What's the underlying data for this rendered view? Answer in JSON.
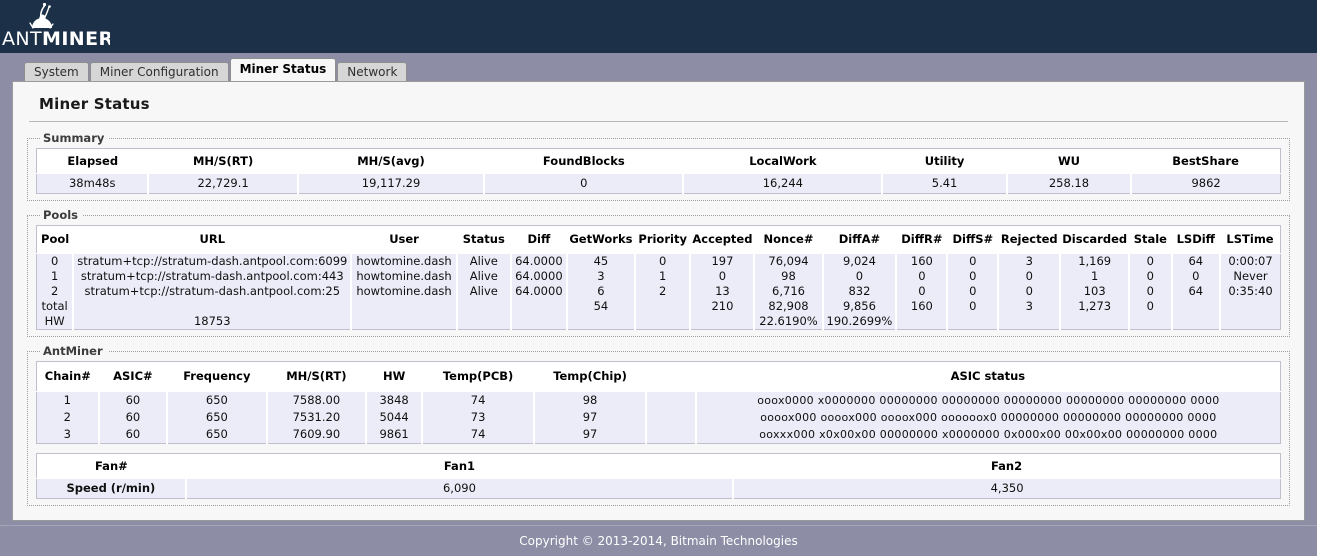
{
  "brand": {
    "name_light": "ANT",
    "name_bold": "MINER",
    "logo_icon": "ant-logo-icon"
  },
  "tabs": [
    {
      "id": "system",
      "label": "System",
      "active": false
    },
    {
      "id": "miner-configuration",
      "label": "Miner Configuration",
      "active": false
    },
    {
      "id": "miner-status",
      "label": "Miner Status",
      "active": true
    },
    {
      "id": "network",
      "label": "Network",
      "active": false
    }
  ],
  "page": {
    "title": "Miner Status"
  },
  "summary": {
    "legend": "Summary",
    "columns": [
      "Elapsed",
      "MH/S(RT)",
      "MH/S(avg)",
      "FoundBlocks",
      "LocalWork",
      "Utility",
      "WU",
      "BestShare"
    ],
    "values": [
      "38m48s",
      "22,729.1",
      "19,117.29",
      "0",
      "16,244",
      "5.41",
      "258.18",
      "9862"
    ]
  },
  "pools": {
    "legend": "Pools",
    "columns": [
      "Pool",
      "URL",
      "User",
      "Status",
      "Diff",
      "GetWorks",
      "Priority",
      "Accepted",
      "Nonce#",
      "DiffA#",
      "DiffR#",
      "DiffS#",
      "Rejected",
      "Discarded",
      "Stale",
      "LSDiff",
      "LSTime"
    ],
    "rows": [
      [
        "0",
        "stratum+tcp://stratum-dash.antpool.com:6099",
        "howtomine.dash",
        "Alive",
        "64.0000",
        "45",
        "0",
        "197",
        "76,094",
        "9,024",
        "160",
        "0",
        "3",
        "1,169",
        "0",
        "64",
        "0:00:07"
      ],
      [
        "1",
        "stratum+tcp://stratum-dash.antpool.com:443",
        "howtomine.dash",
        "Alive",
        "64.0000",
        "3",
        "1",
        "0",
        "98",
        "0",
        "0",
        "0",
        "0",
        "1",
        "0",
        "0",
        "Never"
      ],
      [
        "2",
        "stratum+tcp://stratum-dash.antpool.com:25",
        "howtomine.dash",
        "Alive",
        "64.0000",
        "6",
        "2",
        "13",
        "6,716",
        "832",
        "0",
        "0",
        "0",
        "103",
        "0",
        "64",
        "0:35:40"
      ],
      [
        "total",
        "",
        "",
        "",
        "",
        "54",
        "",
        "210",
        "82,908",
        "9,856",
        "160",
        "0",
        "3",
        "1,273",
        "0",
        "",
        ""
      ],
      [
        "HW",
        "18753",
        "",
        "",
        "",
        "",
        "",
        "",
        "22.6190%",
        "190.2699%",
        "",
        "",
        "",
        "",
        "",
        "",
        ""
      ]
    ]
  },
  "antminer": {
    "legend": "AntMiner",
    "columns": [
      "Chain#",
      "ASIC#",
      "Frequency",
      "MH/S(RT)",
      "HW",
      "Temp(PCB)",
      "Temp(Chip)",
      "",
      "ASIC status"
    ],
    "rows": [
      [
        "1",
        "60",
        "650",
        "7588.00",
        "3848",
        "74",
        "98",
        "",
        "ooox0000 x0000000 00000000 00000000 00000000 00000000 00000000 0000"
      ],
      [
        "2",
        "60",
        "650",
        "7531.20",
        "5044",
        "73",
        "97",
        "",
        "oooox000 oooox000 oooox000 oooooox0 00000000 00000000 00000000 0000"
      ],
      [
        "3",
        "60",
        "650",
        "7609.90",
        "9861",
        "74",
        "97",
        "",
        "ooxxx000 x0x00x00 00000000 x0000000 0x000x00 00x00x00 00000000 0000"
      ]
    ]
  },
  "fans": {
    "columns": [
      "Fan#",
      "Fan1",
      "Fan2"
    ],
    "row_label": "Speed (r/min)",
    "values": [
      "6,090",
      "4,350"
    ]
  },
  "footer": {
    "copyright": "Copyright © 2013-2014, Bitmain Technologies"
  },
  "colors": {
    "header_bg": "#1c3047",
    "page_bg": "#8d8da6",
    "panel_bg": "#f7f7f7",
    "row_bg": "#ececf8"
  }
}
